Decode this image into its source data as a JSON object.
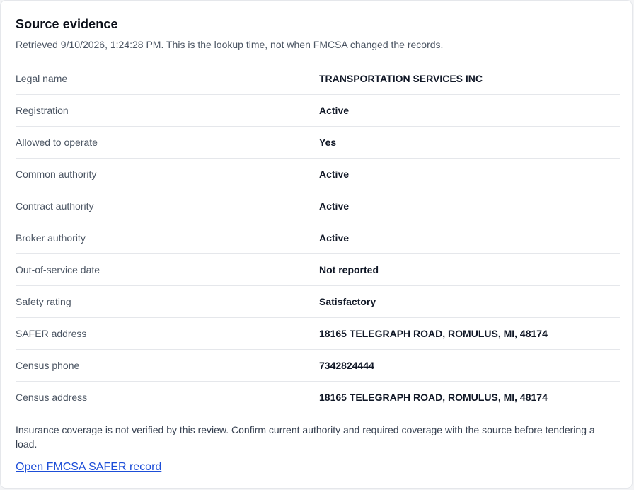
{
  "card": {
    "title": "Source evidence",
    "subtitle": "Retrieved 9/10/2026, 1:24:28 PM. This is the lookup time, not when FMCSA changed the records."
  },
  "rows": [
    {
      "label": "Legal name",
      "value": "TRANSPORTATION SERVICES INC"
    },
    {
      "label": "Registration",
      "value": "Active"
    },
    {
      "label": "Allowed to operate",
      "value": "Yes"
    },
    {
      "label": "Common authority",
      "value": "Active"
    },
    {
      "label": "Contract authority",
      "value": "Active"
    },
    {
      "label": "Broker authority",
      "value": "Active"
    },
    {
      "label": "Out-of-service date",
      "value": "Not reported"
    },
    {
      "label": "Safety rating",
      "value": "Satisfactory"
    },
    {
      "label": "SAFER address",
      "value": "18165 TELEGRAPH ROAD, ROMULUS, MI, 48174"
    },
    {
      "label": "Census phone",
      "value": "7342824444"
    },
    {
      "label": "Census address",
      "value": "18165 TELEGRAPH ROAD, ROMULUS, MI, 48174"
    }
  ],
  "footer": {
    "note": "Insurance coverage is not verified by this review. Confirm current authority and required coverage with the source before tendering a load.",
    "link_label": "Open FMCSA SAFER record"
  },
  "colors": {
    "link": "#1d4ed8",
    "label": "#4b5563",
    "value": "#111827",
    "divider": "#e5e7eb"
  }
}
